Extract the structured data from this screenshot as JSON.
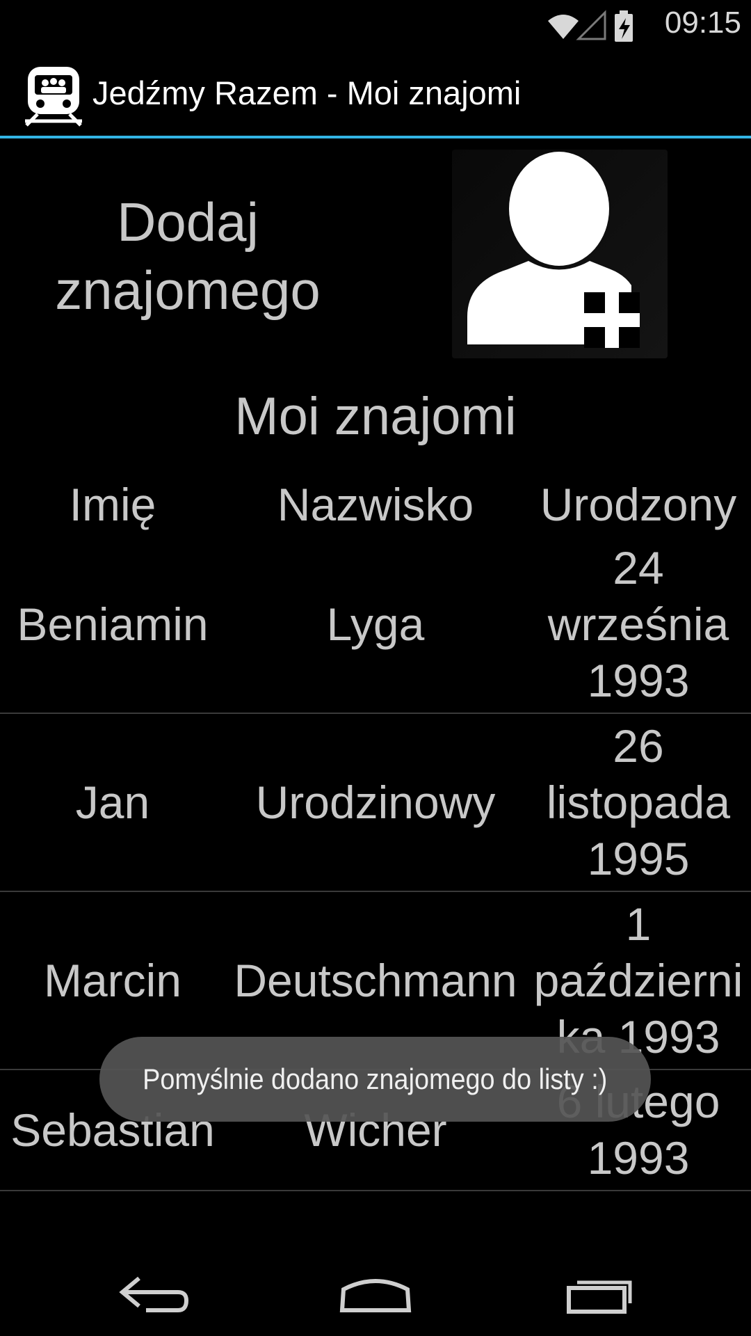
{
  "status_bar": {
    "time": "09:15",
    "icons": [
      "wifi-icon",
      "signal-icon",
      "battery-charging-icon"
    ]
  },
  "action_bar": {
    "title": "Jedźmy Razem - Moi znajomi",
    "icon": "train-icon"
  },
  "add_friend": {
    "label": "Dodaj\nznajomego",
    "icon": "add-person-icon"
  },
  "friends": {
    "title": "Moi znajomi",
    "columns": [
      "Imię",
      "Nazwisko",
      "Urodzony"
    ],
    "rows": [
      {
        "first_name": "Beniamin",
        "last_name": "Lyga",
        "born": "24\nwrześnia\n1993"
      },
      {
        "first_name": "Jan",
        "last_name": "Urodzinowy",
        "born": "26\nlistopada\n1995"
      },
      {
        "first_name": "Marcin",
        "last_name": "Deutschmann",
        "born": "1\npaździerni\nka 1993"
      },
      {
        "first_name": "Sebastian",
        "last_name": "Wicher",
        "born": "6 lutego\n1993"
      }
    ]
  },
  "toast": {
    "message": "Pomyślnie dodano znajomego do listy :)"
  },
  "nav_bar": {
    "buttons": [
      "back-icon",
      "home-icon",
      "recent-apps-icon"
    ]
  },
  "colors": {
    "accent": "#33b5e5",
    "background": "#000000",
    "text": "#c8c8c8"
  }
}
